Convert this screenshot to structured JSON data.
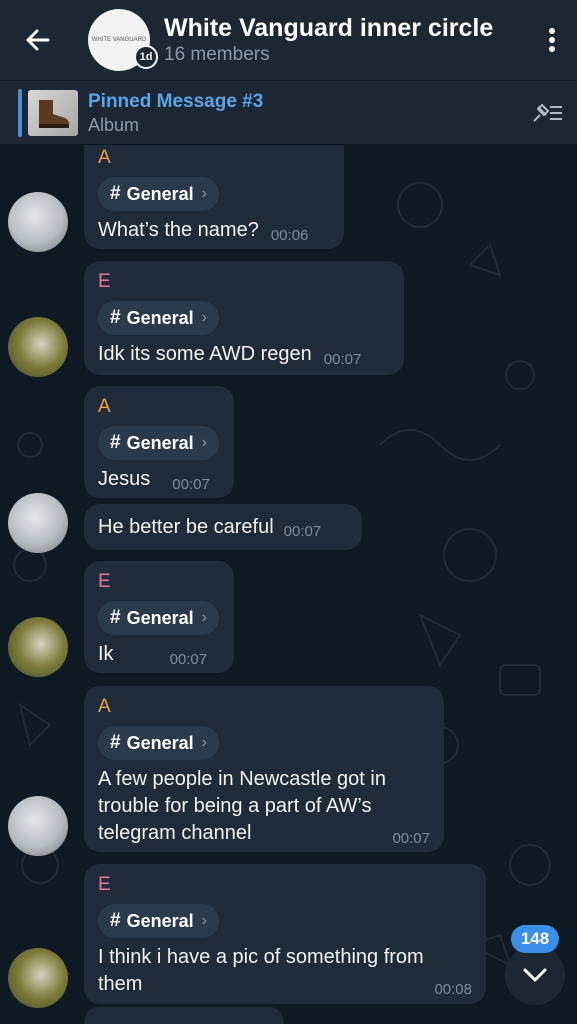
{
  "header": {
    "title": "White Vanguard inner circle",
    "subtitle": "16 members",
    "timer_badge": "1d",
    "logo_text": "WHITE VANGUARD"
  },
  "pinned": {
    "title": "Pinned Message #3",
    "subtitle": "Album"
  },
  "messages": [
    {
      "sender": "A",
      "topic": "General",
      "text": "What’s the name?",
      "time": "00:06"
    },
    {
      "sender": "E",
      "topic": "General",
      "text": "Idk its some AWD regen",
      "time": "00:07"
    },
    {
      "sender": "A",
      "topic": "General",
      "text": "Jesus",
      "time": "00:07"
    },
    {
      "sender": "",
      "topic": "",
      "text": "He better be careful",
      "time": "00:07"
    },
    {
      "sender": "E",
      "topic": "General",
      "text": "Ik",
      "time": "00:07"
    },
    {
      "sender": "A",
      "topic": "General",
      "text_lines": [
        "A few people in Newcastle got in",
        "trouble for being a part of AW’s",
        "telegram channel"
      ],
      "time": "00:07"
    },
    {
      "sender": "E",
      "topic": "General",
      "text_lines": [
        "I think i have a pic of something from",
        "them"
      ],
      "time": "00:08"
    }
  ],
  "scroll": {
    "unread_count": "148"
  },
  "colors": {
    "header_bg": "#1d2733",
    "bubble_bg": "#1f2b38",
    "accent": "#5aa5e8",
    "sender_a": "#e8a04a",
    "sender_e": "#e8749c",
    "badge": "#3a8ee6"
  },
  "icons": {
    "back": "arrow-left-icon",
    "menu": "more-vertical-icon",
    "pin_list": "pin-list-icon",
    "scroll_down": "chevron-down-icon"
  }
}
